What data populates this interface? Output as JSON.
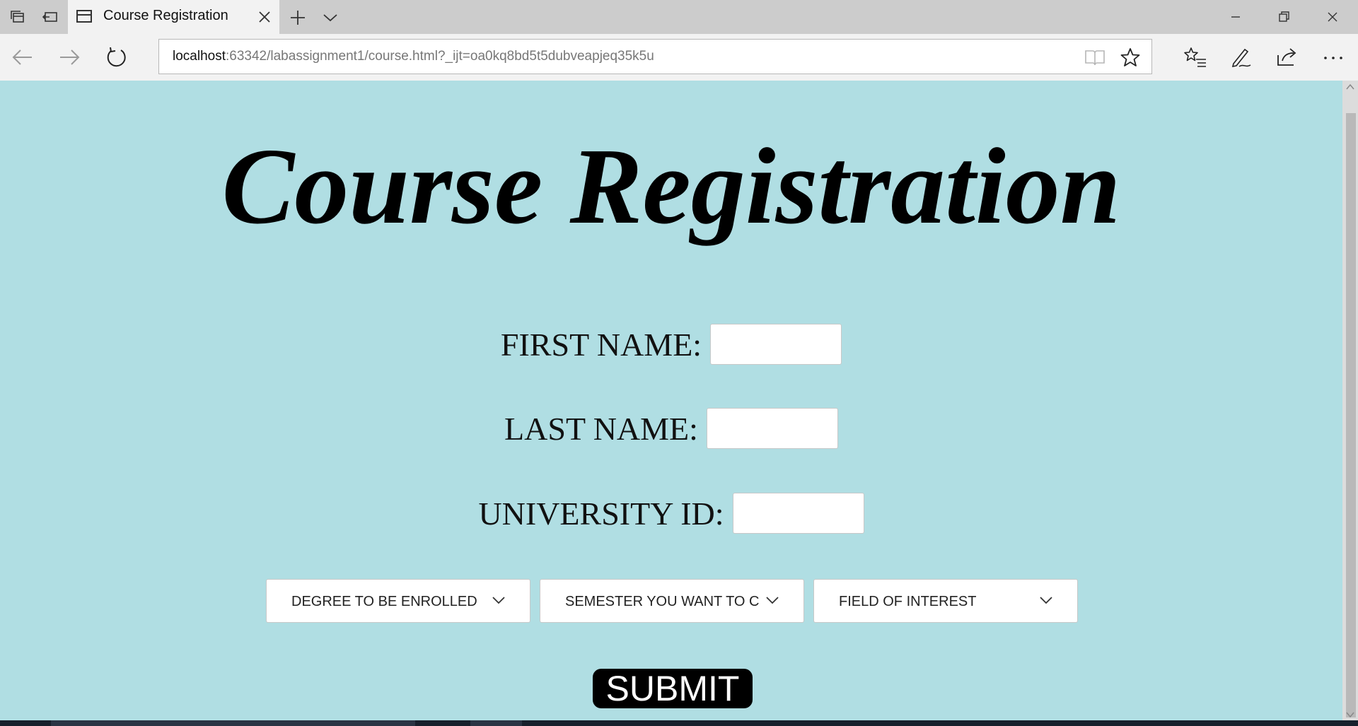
{
  "browser": {
    "tab": {
      "title": "Course Registration"
    },
    "address": {
      "host": "localhost",
      "rest": ":63342/labassignment1/course.html?_ijt=oa0kq8bd5t5dubveapjeq35k5u"
    }
  },
  "page": {
    "title": "Course Registration",
    "fields": {
      "first_name_label": "FIRST NAME:",
      "last_name_label": "LAST NAME:",
      "university_id_label": "UNIVERSITY ID:"
    },
    "selects": {
      "degree": "DEGREE TO BE ENROLLED",
      "semester": "SEMESTER YOU WANT TO C",
      "field": "FIELD OF INTEREST"
    },
    "submit_label": "SUBMIT"
  },
  "colors": {
    "page_background": "#b0dee3",
    "submit_background": "#000000"
  }
}
